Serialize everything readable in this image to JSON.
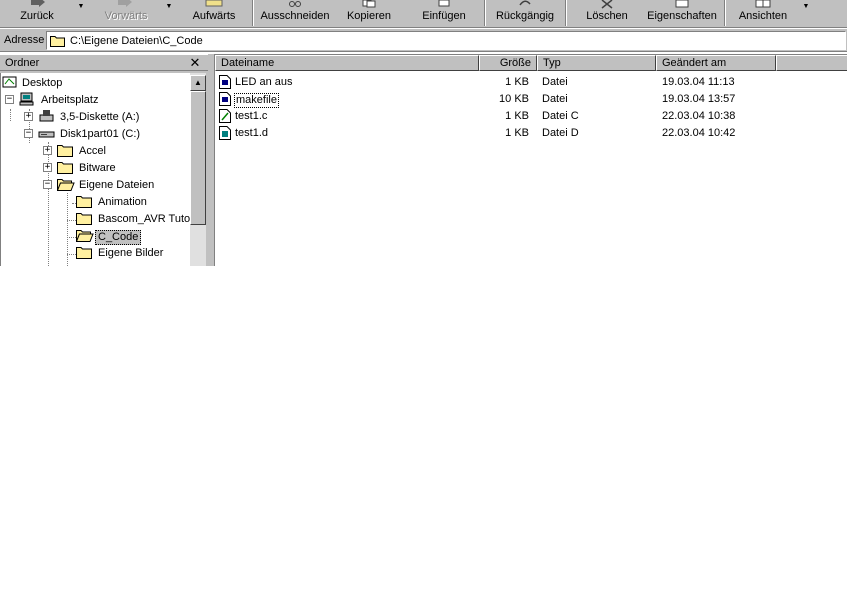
{
  "toolbar": {
    "back_label": "Zurück",
    "forward_label": "Vorwärts",
    "up_label": "Aufwärts",
    "cut_label": "Ausschneiden",
    "copy_label": "Kopieren",
    "paste_label": "Einfügen",
    "undo_label": "Rückgängig",
    "delete_label": "Löschen",
    "properties_label": "Eigenschaften",
    "views_label": "Ansichten",
    "dropdown_glyph": "▼"
  },
  "address": {
    "label": "Adresse",
    "value": "C:\\Eigene Dateien\\C_Code"
  },
  "folder_pane": {
    "title": "Ordner",
    "close_glyph": "✕",
    "tree": [
      {
        "label": "Desktop",
        "icon": "desktop-icon",
        "expander": ""
      },
      {
        "label": "Arbeitsplatz",
        "icon": "computer-icon",
        "expander": "−"
      },
      {
        "label": "3,5-Diskette (A:)",
        "icon": "floppy-drive-icon",
        "expander": "+"
      },
      {
        "label": "Disk1part01 (C:)",
        "icon": "hard-drive-icon",
        "expander": "−"
      },
      {
        "label": "Accel",
        "icon": "folder-icon",
        "expander": "+"
      },
      {
        "label": "Bitware",
        "icon": "folder-icon",
        "expander": "+"
      },
      {
        "label": "Eigene Dateien",
        "icon": "folder-open-icon",
        "expander": "−"
      },
      {
        "label": "Animation",
        "icon": "folder-icon",
        "expander": ""
      },
      {
        "label": "Bascom_AVR Tutor",
        "icon": "folder-icon",
        "expander": ""
      },
      {
        "label": "C_Code",
        "icon": "folder-open-icon",
        "expander": "",
        "selected": true
      },
      {
        "label": "Eigene Bilder",
        "icon": "folder-icon",
        "expander": ""
      }
    ],
    "scroll_up_glyph": "▲"
  },
  "list": {
    "columns": [
      "Dateiname",
      "Größe",
      "Typ",
      "Geändert am"
    ],
    "rows": [
      {
        "name": "LED an aus",
        "size": "1 KB",
        "type": "Datei",
        "modified": "19.03.04 11:13",
        "icon": "generic-file-icon"
      },
      {
        "name": "makefile",
        "size": "10 KB",
        "type": "Datei",
        "modified": "19.03.04 13:57",
        "icon": "generic-file-icon",
        "focused": true
      },
      {
        "name": "test1.c",
        "size": "1 KB",
        "type": "Datei C",
        "modified": "22.03.04 10:38",
        "icon": "c-source-file-icon"
      },
      {
        "name": "test1.d",
        "size": "1 KB",
        "type": "Datei D",
        "modified": "22.03.04 10:42",
        "icon": "d-file-icon"
      }
    ]
  }
}
